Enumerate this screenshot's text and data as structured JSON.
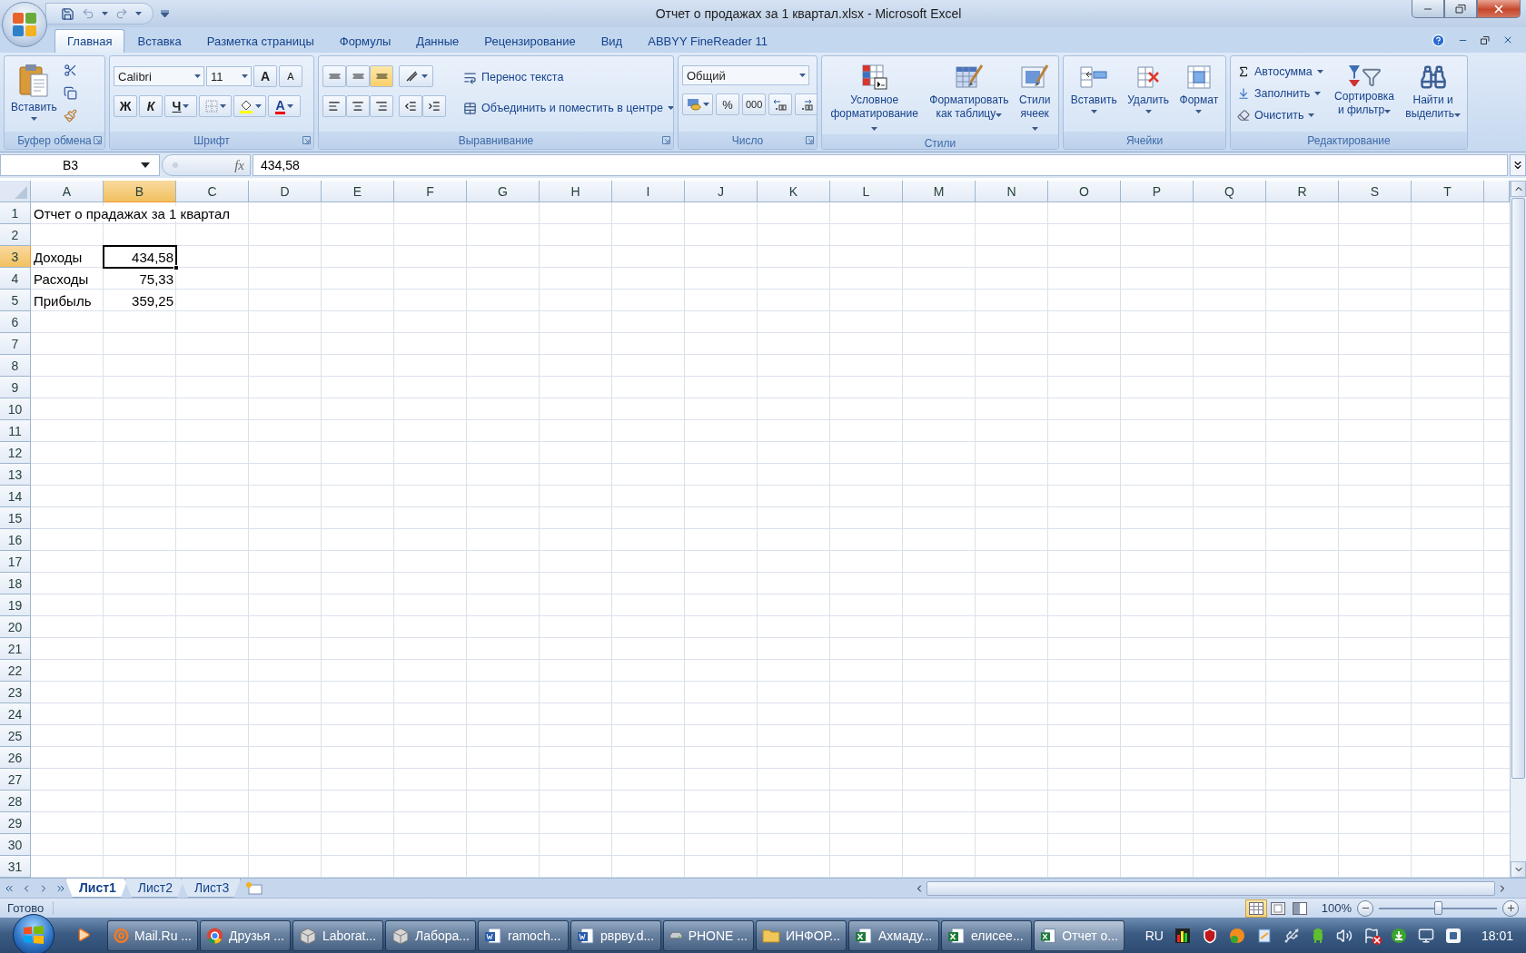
{
  "window": {
    "title": "Отчет о продажах за 1 квартал.xlsx - Microsoft Excel"
  },
  "ribbon_tabs": [
    {
      "label": "Главная",
      "selected": true
    },
    {
      "label": "Вставка",
      "selected": false
    },
    {
      "label": "Разметка страницы",
      "selected": false
    },
    {
      "label": "Формулы",
      "selected": false
    },
    {
      "label": "Данные",
      "selected": false
    },
    {
      "label": "Рецензирование",
      "selected": false
    },
    {
      "label": "Вид",
      "selected": false
    },
    {
      "label": "ABBYY FineReader 11",
      "selected": false
    }
  ],
  "clipboard": {
    "label": "Буфер обмена",
    "paste": "Вставить"
  },
  "font": {
    "label": "Шрифт",
    "name": "Calibri",
    "size": "11",
    "grow": "A",
    "shrink": "A",
    "bold": "Ж",
    "italic": "К",
    "underline": "Ч",
    "color_letter": "A"
  },
  "alignment": {
    "label": "Выравнивание",
    "vertical_align": [
      {
        "selected": false
      },
      {
        "selected": false
      },
      {
        "selected": true
      }
    ],
    "wrap": "Перенос текста",
    "merge": "Объединить и поместить в центре"
  },
  "number": {
    "label": "Число",
    "format": "Общий",
    "percent": "%",
    "thousands": "000"
  },
  "styles": {
    "label": "Стили",
    "buttons": [
      {
        "label": "Условное\nформатирование",
        "kind": "conditional"
      },
      {
        "label": "Форматировать\nкак таблицу",
        "kind": "table"
      },
      {
        "label": "Стили\nячеек",
        "kind": "cellstyles"
      }
    ]
  },
  "cells": {
    "label": "Ячейки",
    "buttons": [
      {
        "label": "Вставить",
        "kind": "insert"
      },
      {
        "label": "Удалить",
        "kind": "delete"
      },
      {
        "label": "Формат",
        "kind": "format"
      }
    ]
  },
  "editing": {
    "label": "Редактирование",
    "small": [
      {
        "label": "Автосумма",
        "kind": "sum"
      },
      {
        "label": "Заполнить",
        "kind": "fill"
      },
      {
        "label": "Очистить",
        "kind": "clear"
      }
    ],
    "big": [
      {
        "label": "Сортировка\nи фильтр",
        "kind": "sort"
      },
      {
        "label": "Найти и\nвыделить",
        "kind": "find"
      }
    ]
  },
  "formula_bar": {
    "name_box": "B3",
    "fx": "fx",
    "value": "434,58"
  },
  "columns": [
    {
      "label": "A",
      "selected": false
    },
    {
      "label": "B",
      "selected": true
    },
    {
      "label": "C",
      "selected": false
    },
    {
      "label": "D",
      "selected": false
    },
    {
      "label": "E",
      "selected": false
    },
    {
      "label": "F",
      "selected": false
    },
    {
      "label": "G",
      "selected": false
    },
    {
      "label": "H",
      "selected": false
    },
    {
      "label": "I",
      "selected": false
    },
    {
      "label": "J",
      "selected": false
    },
    {
      "label": "K",
      "selected": false
    },
    {
      "label": "L",
      "selected": false
    },
    {
      "label": "M",
      "selected": false
    },
    {
      "label": "N",
      "selected": false
    },
    {
      "label": "O",
      "selected": false
    },
    {
      "label": "P",
      "selected": false
    },
    {
      "label": "Q",
      "selected": false
    },
    {
      "label": "R",
      "selected": false
    },
    {
      "label": "S",
      "selected": false
    },
    {
      "label": "T",
      "selected": false
    }
  ],
  "rows": [
    {
      "number": "1",
      "selected": false,
      "a": "Отчет о прадажах за 1 квартал"
    },
    {
      "number": "2",
      "selected": false
    },
    {
      "number": "3",
      "selected": true,
      "a": "Доходы",
      "b": {
        "text": "434,58",
        "active": true
      }
    },
    {
      "number": "4",
      "selected": false,
      "a": "Расходы",
      "b": {
        "text": "75,33",
        "active": false
      }
    },
    {
      "number": "5",
      "selected": false,
      "a": "Прибыль",
      "b": {
        "text": "359,25",
        "active": false
      }
    },
    {
      "number": "6",
      "selected": false
    },
    {
      "number": "7",
      "selected": false
    },
    {
      "number": "8",
      "selected": false
    },
    {
      "number": "9",
      "selected": false
    },
    {
      "number": "10",
      "selected": false
    },
    {
      "number": "11",
      "selected": false
    },
    {
      "number": "12",
      "selected": false
    },
    {
      "number": "13",
      "selected": false
    },
    {
      "number": "14",
      "selected": false
    },
    {
      "number": "15",
      "selected": false
    },
    {
      "number": "16",
      "selected": false
    },
    {
      "number": "17",
      "selected": false
    },
    {
      "number": "18",
      "selected": false
    },
    {
      "number": "19",
      "selected": false
    },
    {
      "number": "20",
      "selected": false
    },
    {
      "number": "21",
      "selected": false
    },
    {
      "number": "22",
      "selected": false
    },
    {
      "number": "23",
      "selected": false
    },
    {
      "number": "24",
      "selected": false
    },
    {
      "number": "25",
      "selected": false
    },
    {
      "number": "26",
      "selected": false
    },
    {
      "number": "27",
      "selected": false
    },
    {
      "number": "28",
      "selected": false
    },
    {
      "number": "29",
      "selected": false
    },
    {
      "number": "30",
      "selected": false
    },
    {
      "number": "31",
      "selected": false
    }
  ],
  "sheets": [
    {
      "label": "Лист1",
      "selected": true
    },
    {
      "label": "Лист2",
      "selected": false
    },
    {
      "label": "Лист3",
      "selected": false
    }
  ],
  "status": {
    "text": "Готово",
    "views": [
      {
        "selected": true
      },
      {
        "selected": false
      },
      {
        "selected": false
      }
    ],
    "zoom": "100%",
    "level": 0.5
  },
  "taskbar": {
    "tasks": [
      {
        "label": "Mail.Ru ...",
        "kind": "mail",
        "active": false
      },
      {
        "label": "Друзья ...",
        "kind": "chrome",
        "active": false
      },
      {
        "label": "Laborat...",
        "kind": "box",
        "active": false
      },
      {
        "label": "Лабора...",
        "kind": "box",
        "active": false
      },
      {
        "label": "ramoch...",
        "kind": "word",
        "active": false
      },
      {
        "label": "рврву.d...",
        "kind": "word",
        "active": false
      },
      {
        "label": "PHONE ...",
        "kind": "drive",
        "active": false
      },
      {
        "label": "ИНФОР...",
        "kind": "folder",
        "active": false
      },
      {
        "label": "Ахмаду...",
        "kind": "excel",
        "active": false
      },
      {
        "label": "елисее...",
        "kind": "excel",
        "active": false
      },
      {
        "label": "Отчет о...",
        "kind": "excel",
        "active": true
      }
    ],
    "language": "RU",
    "clock": "18:01"
  }
}
